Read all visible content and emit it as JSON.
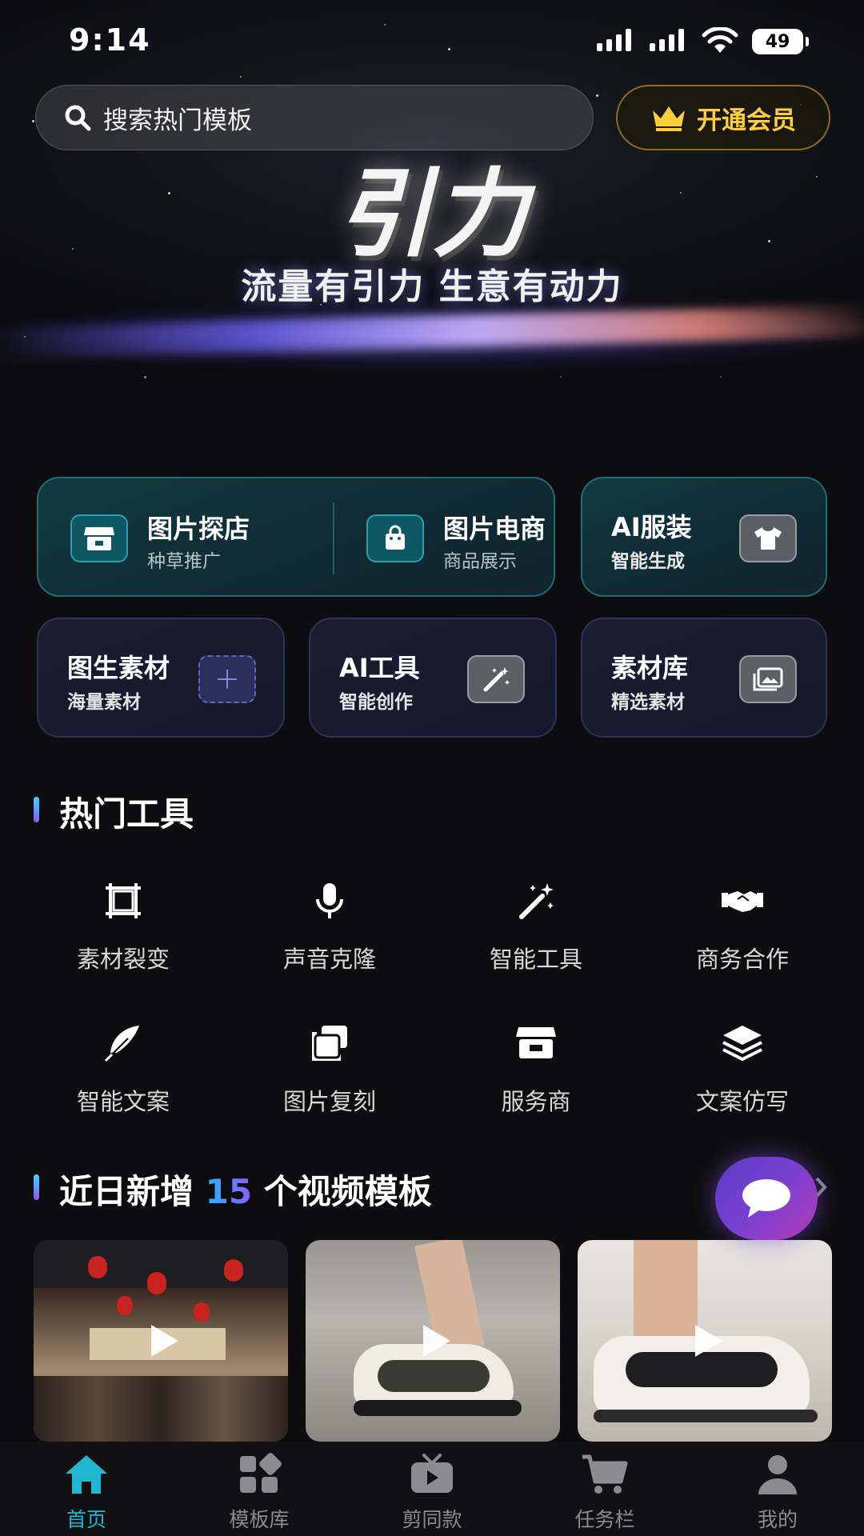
{
  "status_bar": {
    "time": "9:14",
    "battery": "49"
  },
  "search": {
    "placeholder": "搜索热门模板"
  },
  "vip": {
    "label": "开通会员"
  },
  "hero": {
    "logo": "引力",
    "slogan": "流量有引力 生意有动力"
  },
  "features": {
    "store_visit": {
      "title": "图片探店",
      "sub": "种草推广",
      "icon": "storefront-icon"
    },
    "ecommerce": {
      "title": "图片电商",
      "sub": "商品展示",
      "icon": "shopping-bag-icon"
    },
    "ai_clothing": {
      "title": "AI服装",
      "sub": "智能生成",
      "icon": "tshirt-icon"
    },
    "image_material": {
      "title": "图生素材",
      "sub": "海量素材",
      "icon": "plus-icon"
    },
    "ai_tools": {
      "title": "AI工具",
      "sub": "智能创作",
      "icon": "magic-wand-icon"
    },
    "material_library": {
      "title": "素材库",
      "sub": "精选素材",
      "icon": "image-gallery-icon"
    }
  },
  "hot_tools": {
    "title": "热门工具",
    "items": [
      {
        "label": "素材裂变",
        "icon": "crop-frame-icon"
      },
      {
        "label": "声音克隆",
        "icon": "microphone-icon"
      },
      {
        "label": "智能工具",
        "icon": "magic-wand-icon"
      },
      {
        "label": "商务合作",
        "icon": "handshake-icon"
      },
      {
        "label": "智能文案",
        "icon": "feather-icon"
      },
      {
        "label": "图片复刻",
        "icon": "copy-images-icon"
      },
      {
        "label": "服务商",
        "icon": "storefront-icon"
      },
      {
        "label": "文案仿写",
        "icon": "layers-icon"
      }
    ]
  },
  "templates": {
    "title_prefix": "近日新增",
    "count": "15",
    "title_suffix": "个视频模板",
    "items": [
      {
        "name": "restaurant-video"
      },
      {
        "name": "sneaker-video-1"
      },
      {
        "name": "sneaker-video-2"
      }
    ]
  },
  "tabbar": {
    "items": [
      {
        "label": "首页",
        "icon": "home-icon",
        "active": true
      },
      {
        "label": "模板库",
        "icon": "grid-icon",
        "active": false
      },
      {
        "label": "剪同款",
        "icon": "tv-play-icon",
        "active": false
      },
      {
        "label": "任务栏",
        "icon": "cart-icon",
        "active": false
      },
      {
        "label": "我的",
        "icon": "user-icon",
        "active": false
      }
    ]
  },
  "colors": {
    "accent": "#20b8d0",
    "vip_gold": "#ffcf3a",
    "background": "#0d0d0f"
  }
}
